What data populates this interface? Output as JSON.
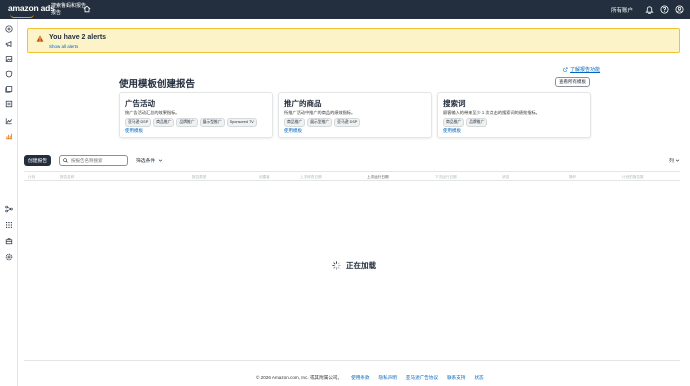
{
  "header": {
    "logo": "amazon ads",
    "account_line1": "搜索鲁蚂和报告",
    "account_line2": "报告",
    "all_accounts": "所有账户"
  },
  "alert": {
    "title": "You have 2 alerts",
    "link": "Show all alerts"
  },
  "learn_link": "了解报告功能",
  "templates": {
    "title": "使用模板创建报告",
    "view_all": "查看所有模板",
    "cards": [
      {
        "title": "广告活动",
        "desc": "按广告活动汇总的效果指标。",
        "tags": [
          "亚马逊 DSP",
          "商品推广",
          "品牌推广",
          "展示型推广",
          "Sponsored TV"
        ],
        "use": "使用模板"
      },
      {
        "title": "推广的商品",
        "desc": "所推广活动中推广的商品的绩效指标。",
        "tags": [
          "商品推广",
          "展示型推广",
          "亚马逊 DSP"
        ],
        "use": "使用模板"
      },
      {
        "title": "搜索词",
        "desc": "顾客输入的带来至少 1 次点击的搜索词的绩效指标。",
        "tags": [
          "商品推广",
          "品牌推广"
        ],
        "use": "使用模板"
      }
    ]
  },
  "toolbar": {
    "create": "创建报告",
    "search_placeholder": "按报告名称搜索",
    "filter": "筛选条件",
    "columns": "列"
  },
  "table": {
    "headers": [
      "计划",
      "报告名称",
      "报告类型",
      "创建者",
      "上次修改日期",
      "上次运行日期",
      "下次运行日期",
      "状态",
      "操作",
      "计划的报告数"
    ]
  },
  "loading": "正在加载",
  "footer": {
    "copyright": "© 2026 Amazon.com, Inc. 或其附属公司。",
    "links": [
      "使用条款",
      "隐私声明",
      "亚马逊广告协议",
      "联系支持",
      "状态"
    ]
  }
}
